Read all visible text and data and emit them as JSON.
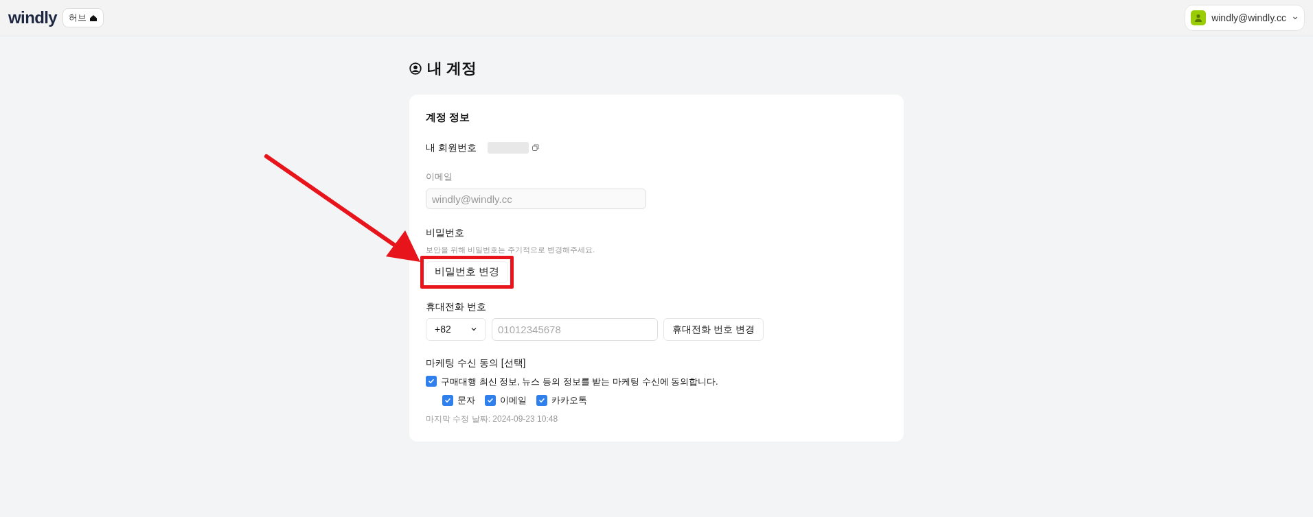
{
  "header": {
    "logo": "windly",
    "hub_badge": "허브",
    "account": {
      "email": "windly@windly.cc"
    }
  },
  "page_title": "내 계정",
  "card": {
    "title": "계정 정보",
    "member_number": {
      "label": "내 회원번호"
    },
    "email": {
      "label": "이메일",
      "value": "windly@windly.cc",
      "disabled": true
    },
    "password": {
      "label": "비밀번호",
      "hint": "보안을 위해 비밀번호는 주기적으로 변경해주세요.",
      "button": "비밀번호 변경",
      "highlighted": true
    },
    "phone": {
      "label": "휴대전화 번호",
      "country_code": "+82",
      "placeholder": "01012345678",
      "button": "휴대전화 번호 변경"
    },
    "marketing": {
      "label": "마케팅 수신 동의 [선택]",
      "consent": {
        "label": "구매대행 최신 정보, 뉴스 등의 정보를 받는 마케팅 수신에 동의합니다.",
        "checked": true
      },
      "channels": [
        {
          "label": "문자",
          "checked": true
        },
        {
          "label": "이메일",
          "checked": true
        },
        {
          "label": "카카오톡",
          "checked": true
        }
      ],
      "last_modified": "마지막 수정 날짜: 2024-09-23 10:48"
    }
  },
  "annotation": {
    "arrow": true
  }
}
